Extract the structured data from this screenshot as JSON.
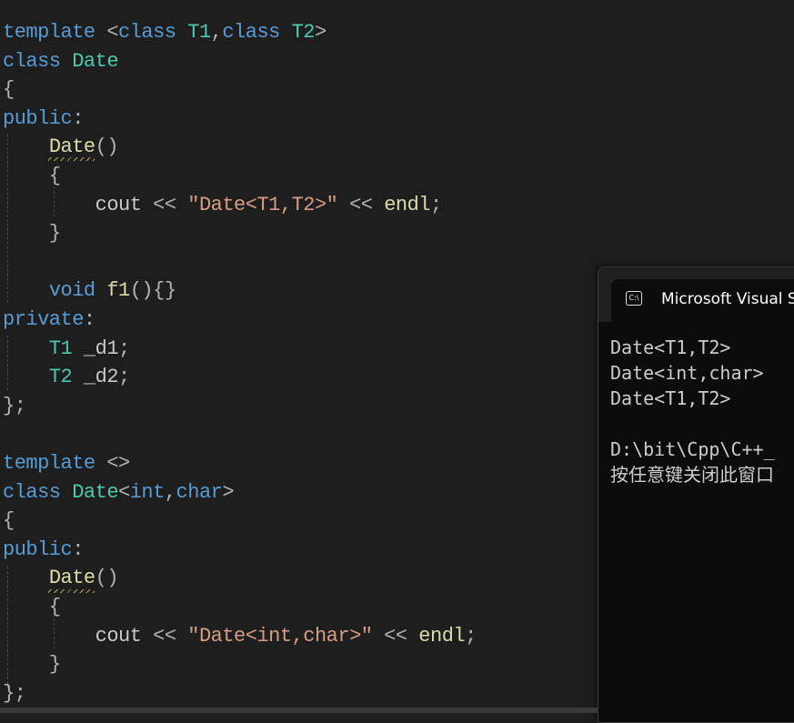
{
  "colors": {
    "background": "#1e1e1e",
    "keyword": "#569cd6",
    "type": "#4ec9b0",
    "function": "#dcdcaa",
    "string": "#d69d85",
    "plain": "#d4d4d4",
    "punctuation": "#b4b4b4",
    "identifier": "#c8c8c8",
    "console_background": "#0c0c0c",
    "console_text": "#cccccc"
  },
  "editor": {
    "lines": [
      [
        {
          "t": "template",
          "c": "keyword"
        },
        {
          "t": " ",
          "c": "plain"
        },
        {
          "t": "<",
          "c": "punctuation"
        },
        {
          "t": "class",
          "c": "keyword"
        },
        {
          "t": " ",
          "c": "plain"
        },
        {
          "t": "T1",
          "c": "type"
        },
        {
          "t": ",",
          "c": "punctuation"
        },
        {
          "t": "class",
          "c": "keyword"
        },
        {
          "t": " ",
          "c": "plain"
        },
        {
          "t": "T2",
          "c": "type"
        },
        {
          "t": ">",
          "c": "punctuation"
        }
      ],
      [
        {
          "t": "class",
          "c": "keyword"
        },
        {
          "t": " ",
          "c": "plain"
        },
        {
          "t": "Date",
          "c": "type"
        }
      ],
      [
        {
          "t": "{",
          "c": "punctuation"
        }
      ],
      [
        {
          "t": "public",
          "c": "keyword"
        },
        {
          "t": ":",
          "c": "punctuation"
        }
      ],
      [
        {
          "t": "    ",
          "c": "plain"
        },
        {
          "t": "Date",
          "c": "function"
        },
        {
          "t": "()",
          "c": "punctuation"
        }
      ],
      [
        {
          "t": "    ",
          "c": "plain"
        },
        {
          "t": "{",
          "c": "punctuation"
        }
      ],
      [
        {
          "t": "        ",
          "c": "plain"
        },
        {
          "t": "cout",
          "c": "identifier"
        },
        {
          "t": " << ",
          "c": "punctuation"
        },
        {
          "t": "\"Date<T1,T2>\"",
          "c": "string"
        },
        {
          "t": " << ",
          "c": "punctuation"
        },
        {
          "t": "endl",
          "c": "function"
        },
        {
          "t": ";",
          "c": "punctuation"
        }
      ],
      [
        {
          "t": "    ",
          "c": "plain"
        },
        {
          "t": "}",
          "c": "punctuation"
        }
      ],
      [],
      [
        {
          "t": "    ",
          "c": "plain"
        },
        {
          "t": "void",
          "c": "keyword"
        },
        {
          "t": " ",
          "c": "plain"
        },
        {
          "t": "f1",
          "c": "function"
        },
        {
          "t": "(){}",
          "c": "punctuation"
        }
      ],
      [
        {
          "t": "private",
          "c": "keyword"
        },
        {
          "t": ":",
          "c": "punctuation"
        }
      ],
      [
        {
          "t": "    ",
          "c": "plain"
        },
        {
          "t": "T1",
          "c": "type"
        },
        {
          "t": " _d1",
          "c": "identifier"
        },
        {
          "t": ";",
          "c": "punctuation"
        }
      ],
      [
        {
          "t": "    ",
          "c": "plain"
        },
        {
          "t": "T2",
          "c": "type"
        },
        {
          "t": " _d2",
          "c": "identifier"
        },
        {
          "t": ";",
          "c": "punctuation"
        }
      ],
      [
        {
          "t": "};",
          "c": "punctuation"
        }
      ],
      [],
      [
        {
          "t": "template",
          "c": "keyword"
        },
        {
          "t": " ",
          "c": "plain"
        },
        {
          "t": "<>",
          "c": "punctuation"
        }
      ],
      [
        {
          "t": "class",
          "c": "keyword"
        },
        {
          "t": " ",
          "c": "plain"
        },
        {
          "t": "Date",
          "c": "type"
        },
        {
          "t": "<",
          "c": "punctuation"
        },
        {
          "t": "int",
          "c": "keyword"
        },
        {
          "t": ",",
          "c": "punctuation"
        },
        {
          "t": "char",
          "c": "keyword"
        },
        {
          "t": ">",
          "c": "punctuation"
        }
      ],
      [
        {
          "t": "{",
          "c": "punctuation"
        }
      ],
      [
        {
          "t": "public",
          "c": "keyword"
        },
        {
          "t": ":",
          "c": "punctuation"
        }
      ],
      [
        {
          "t": "    ",
          "c": "plain"
        },
        {
          "t": "Date",
          "c": "function"
        },
        {
          "t": "()",
          "c": "punctuation"
        }
      ],
      [
        {
          "t": "    ",
          "c": "plain"
        },
        {
          "t": "{",
          "c": "punctuation"
        }
      ],
      [
        {
          "t": "        ",
          "c": "plain"
        },
        {
          "t": "cout",
          "c": "identifier"
        },
        {
          "t": " << ",
          "c": "punctuation"
        },
        {
          "t": "\"Date<int,char>\"",
          "c": "string"
        },
        {
          "t": " << ",
          "c": "punctuation"
        },
        {
          "t": "endl",
          "c": "function"
        },
        {
          "t": ";",
          "c": "punctuation"
        }
      ],
      [
        {
          "t": "    ",
          "c": "plain"
        },
        {
          "t": "}",
          "c": "punctuation"
        }
      ],
      [
        {
          "t": "};",
          "c": "punctuation"
        }
      ]
    ]
  },
  "console": {
    "icon": "console-app-icon",
    "icon_glyph": "C:\\",
    "title": "Microsoft Visual Studio Debug Console",
    "lines": [
      "Date<T1,T2>",
      "Date<int,char>",
      "Date<T1,T2>",
      "",
      "D:\\bit\\Cpp\\C++_",
      "按任意键关闭此窗口"
    ]
  }
}
